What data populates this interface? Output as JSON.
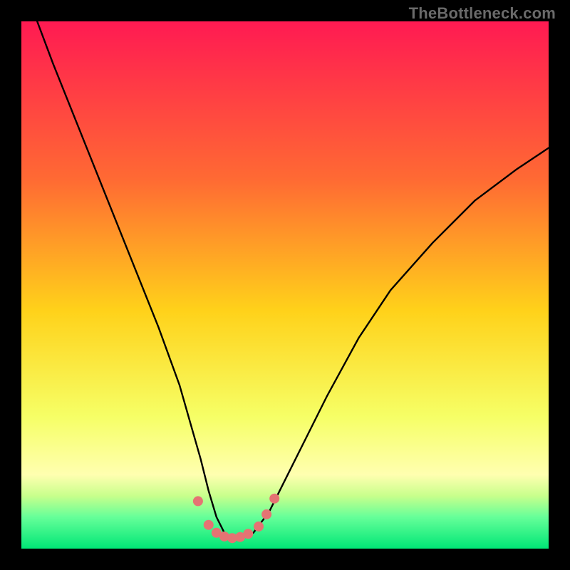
{
  "watermark": "TheBottleneck.com",
  "chart_data": {
    "type": "line",
    "title": "",
    "xlabel": "",
    "ylabel": "",
    "xlim": [
      0,
      100
    ],
    "ylim": [
      0,
      100
    ],
    "legend": false,
    "grid": false,
    "background_gradient": {
      "stops": [
        {
          "offset": 0.0,
          "color": "#ff1a52"
        },
        {
          "offset": 0.3,
          "color": "#ff6a33"
        },
        {
          "offset": 0.55,
          "color": "#ffd21a"
        },
        {
          "offset": 0.75,
          "color": "#f6ff66"
        },
        {
          "offset": 0.86,
          "color": "#ffffb0"
        },
        {
          "offset": 0.9,
          "color": "#c8ff8c"
        },
        {
          "offset": 0.94,
          "color": "#66ff99"
        },
        {
          "offset": 1.0,
          "color": "#00e676"
        }
      ]
    },
    "series": [
      {
        "name": "bottleneck-curve",
        "color": "#000000",
        "x": [
          3,
          6,
          10,
          14,
          18,
          22,
          26,
          30,
          32,
          34,
          35.5,
          37,
          38.5,
          40,
          42,
          44,
          47,
          50,
          54,
          58,
          64,
          70,
          78,
          86,
          94,
          100
        ],
        "y": [
          100,
          92,
          82,
          72,
          62,
          52,
          42,
          31,
          24,
          17,
          11,
          6,
          3,
          2,
          2,
          3,
          7,
          13,
          21,
          29,
          40,
          49,
          58,
          66,
          72,
          76
        ]
      }
    ],
    "markers": {
      "name": "highlight-dots",
      "color": "#e57373",
      "radius": 7,
      "points": [
        {
          "x": 33.5,
          "y": 9
        },
        {
          "x": 35.5,
          "y": 4.5
        },
        {
          "x": 37,
          "y": 3
        },
        {
          "x": 38.5,
          "y": 2.3
        },
        {
          "x": 40,
          "y": 2
        },
        {
          "x": 41.5,
          "y": 2.2
        },
        {
          "x": 43,
          "y": 2.8
        },
        {
          "x": 45,
          "y": 4.2
        },
        {
          "x": 46.5,
          "y": 6.5
        },
        {
          "x": 48,
          "y": 9.5
        }
      ]
    }
  }
}
